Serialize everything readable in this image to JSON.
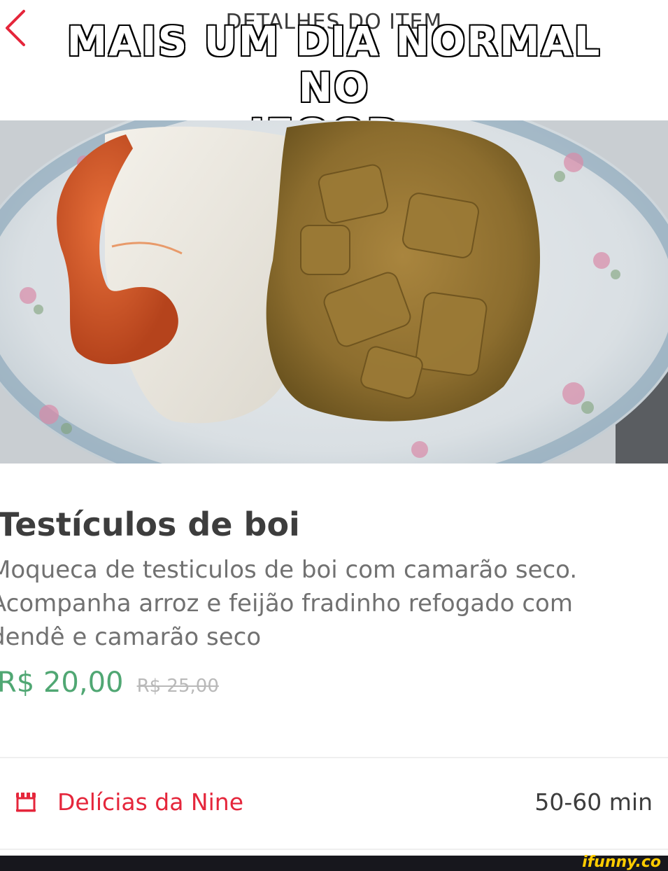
{
  "header": {
    "title": "DETALHES DO ITEM",
    "back_icon": "chevron-left-icon"
  },
  "meme": {
    "caption_line1": "MAIS UM DIA NORMAL NO",
    "caption_line2": "IFOOD."
  },
  "item": {
    "name": "Testículos de boi",
    "description_line1": "Moqueca de testiculos de boi com camarão seco.",
    "description_line2": "Acompanha arroz e feijão fradinho refogado com",
    "description_line3": "dendê e camarão seco",
    "price": "R$  20,00",
    "old_price": "R$ 25,00"
  },
  "store": {
    "icon": "store-icon",
    "name": "Delícias da Nine",
    "delivery_time": "50-60 min"
  },
  "watermark": "ifunny.co",
  "colors": {
    "accent": "#e5263b",
    "price": "#50a773",
    "old_price": "#b9b9b9",
    "text_dark": "#3d3d3d",
    "text_muted": "#717171"
  }
}
